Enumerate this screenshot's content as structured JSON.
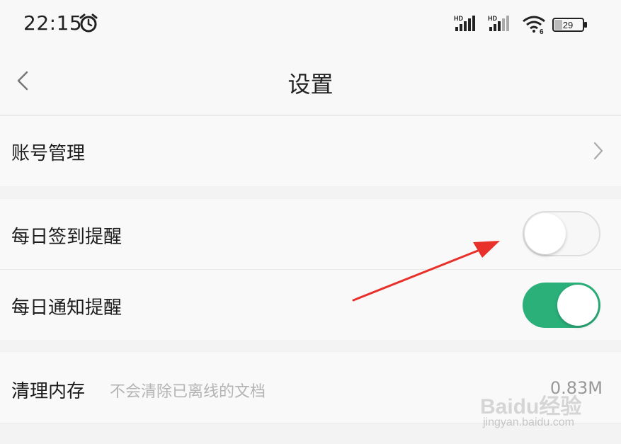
{
  "status_bar": {
    "time": "22:15",
    "battery": "29",
    "signal_label": "HD",
    "wifi_label": "6"
  },
  "nav": {
    "title": "设置"
  },
  "settings": {
    "account": {
      "label": "账号管理"
    },
    "daily_checkin": {
      "label": "每日签到提醒",
      "enabled": false
    },
    "daily_notify": {
      "label": "每日通知提醒",
      "enabled": true
    },
    "clear_cache": {
      "label": "清理内存",
      "hint": "不会清除已离线的文档",
      "value": "0.83M"
    }
  },
  "colors": {
    "toggle_on": "#2bb07a",
    "arrow": "#e8312a"
  },
  "watermark": {
    "brand": "Baidu经验",
    "url": "jingyan.baidu.com"
  }
}
